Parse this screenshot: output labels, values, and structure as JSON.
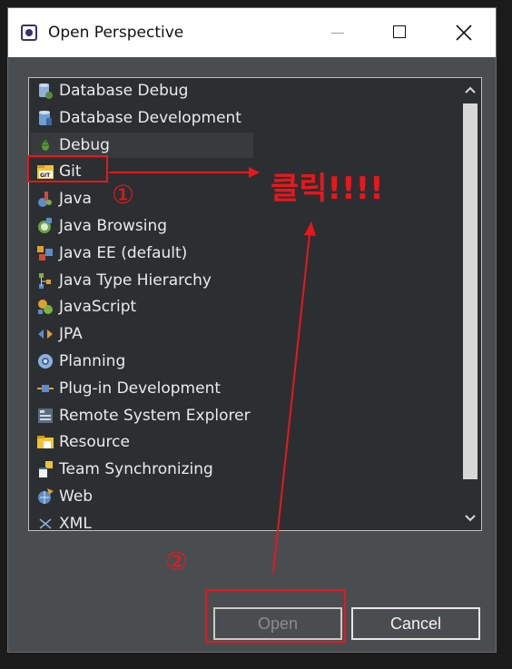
{
  "window": {
    "title": "Open Perspective",
    "controls": {
      "minimize": "minimize",
      "maximize": "maximize",
      "close": "close"
    }
  },
  "perspectives": [
    {
      "label": "Database Debug",
      "icon": "database-debug-icon"
    },
    {
      "label": "Database Development",
      "icon": "database-development-icon"
    },
    {
      "label": "Debug",
      "icon": "debug-bug-icon",
      "selected": true
    },
    {
      "label": "Git",
      "icon": "git-icon"
    },
    {
      "label": "Java",
      "icon": "java-icon"
    },
    {
      "label": "Java Browsing",
      "icon": "java-browsing-icon"
    },
    {
      "label": "Java EE (default)",
      "icon": "java-ee-icon"
    },
    {
      "label": "Java Type Hierarchy",
      "icon": "type-hierarchy-icon"
    },
    {
      "label": "JavaScript",
      "icon": "javascript-icon"
    },
    {
      "label": "JPA",
      "icon": "jpa-icon"
    },
    {
      "label": "Planning",
      "icon": "planning-icon"
    },
    {
      "label": "Plug-in Development",
      "icon": "plugin-icon"
    },
    {
      "label": "Remote System Explorer",
      "icon": "remote-system-icon"
    },
    {
      "label": "Resource",
      "icon": "resource-folder-icon"
    },
    {
      "label": "Team Synchronizing",
      "icon": "team-sync-icon"
    },
    {
      "label": "Web",
      "icon": "web-icon"
    },
    {
      "label": "XML",
      "icon": "xml-icon"
    }
  ],
  "buttons": {
    "open": "Open",
    "cancel": "Cancel"
  },
  "annotations": {
    "click_text": "클릭!!!!",
    "step_one": "①",
    "step_two": "②",
    "color": "#e8171b"
  },
  "colors": {
    "dialog_bg": "#4a4d50",
    "list_bg": "#2c2f31",
    "selected_row": "#383b3d",
    "text": "#eaeaea"
  }
}
